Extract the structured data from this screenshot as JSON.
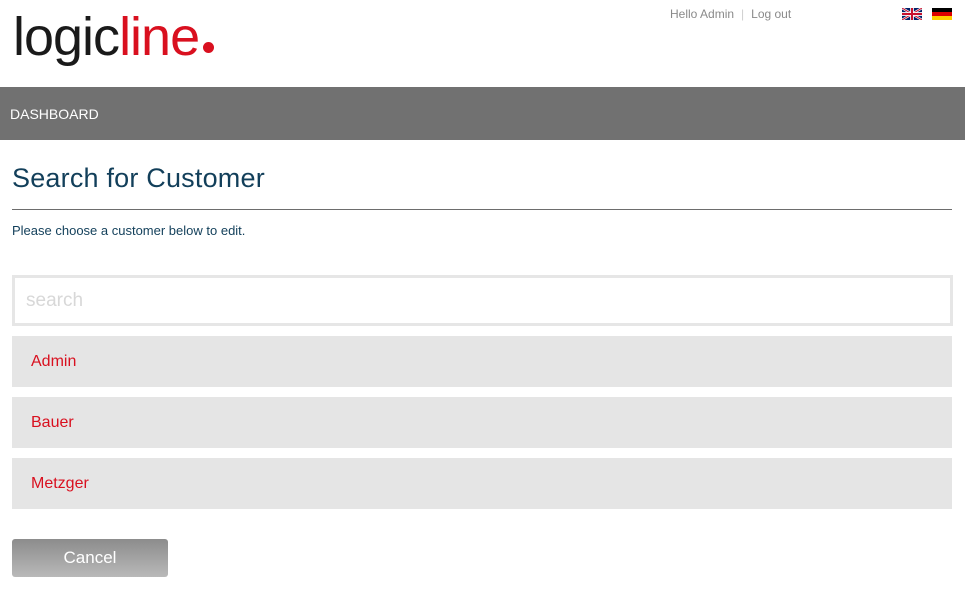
{
  "header": {
    "logo": {
      "part1": "logic",
      "part2": "line",
      "brand_color": "#d9101f"
    },
    "greeting": "Hello Admin",
    "separator": "|",
    "logout_label": "Log out",
    "flags": [
      {
        "icon": "uk-flag-icon"
      },
      {
        "icon": "germany-flag-icon"
      }
    ]
  },
  "nav": {
    "items": [
      {
        "label": "DASHBOARD"
      }
    ],
    "background": "#717171"
  },
  "main": {
    "title": "Search for Customer",
    "instructions": "Please choose a customer below to edit.",
    "search": {
      "placeholder": "search",
      "value": ""
    },
    "customers": [
      {
        "name": "Admin"
      },
      {
        "name": "Bauer"
      },
      {
        "name": "Metzger"
      }
    ],
    "cancel_label": "Cancel"
  }
}
